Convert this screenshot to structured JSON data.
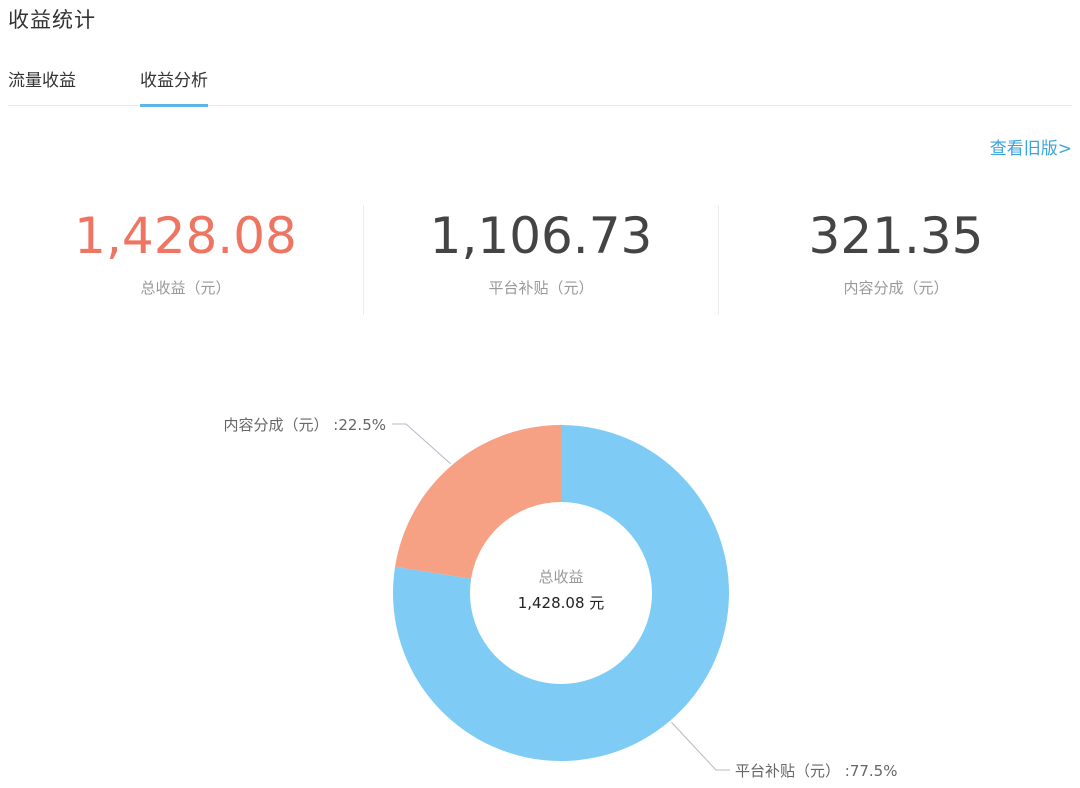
{
  "page": {
    "title": "收益统计"
  },
  "tabs": [
    {
      "label": "流量收益",
      "active": false
    },
    {
      "label": "收益分析",
      "active": true
    }
  ],
  "links": {
    "old_version": "查看旧版>"
  },
  "stats": [
    {
      "value": "1,428.08",
      "label": "总收益（元）",
      "color": "#ef7563"
    },
    {
      "value": "1,106.73",
      "label": "平台补贴（元）",
      "color": "#444444"
    },
    {
      "value": "321.35",
      "label": "内容分成（元）",
      "color": "#444444"
    }
  ],
  "chart_data": {
    "type": "pie",
    "center_title": "总收益",
    "center_value": "1,428.08 元",
    "slices": [
      {
        "label": "内容分成（元） :22.5%",
        "percent": 22.5,
        "value": 321.35,
        "color": "#f6a084"
      },
      {
        "label": "平台补贴（元） :77.5%",
        "percent": 77.5,
        "value": 1106.73,
        "color": "#7ecbf5"
      }
    ]
  }
}
